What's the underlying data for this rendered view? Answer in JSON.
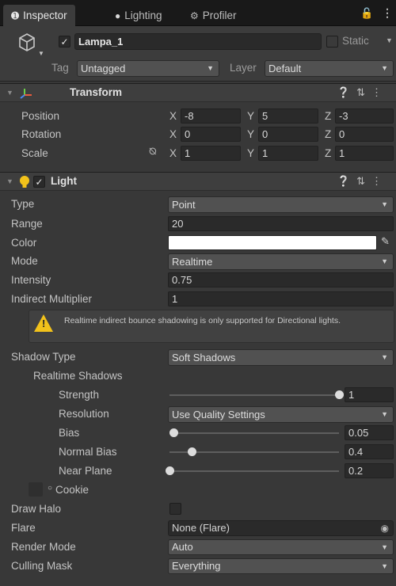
{
  "tabs": [
    {
      "label": "Inspector",
      "icon": "info-icon"
    },
    {
      "label": "Lighting",
      "icon": "bulb-icon"
    },
    {
      "label": "Profiler",
      "icon": "profiler-icon"
    }
  ],
  "object": {
    "name": "Lampa_1",
    "static_label": "Static",
    "tag_label": "Tag",
    "tag_value": "Untagged",
    "layer_label": "Layer",
    "layer_value": "Default"
  },
  "transform": {
    "title": "Transform",
    "rows": [
      {
        "label": "Position",
        "x": "-8",
        "y": "5",
        "z": "-3"
      },
      {
        "label": "Rotation",
        "x": "0",
        "y": "0",
        "z": "0"
      },
      {
        "label": "Scale",
        "x": "1",
        "y": "1",
        "z": "1"
      }
    ],
    "axis": {
      "x": "X",
      "y": "Y",
      "z": "Z"
    }
  },
  "light": {
    "title": "Light",
    "type_label": "Type",
    "type_value": "Point",
    "range_label": "Range",
    "range_value": "20",
    "color_label": "Color",
    "color_value": "#ffffff",
    "mode_label": "Mode",
    "mode_value": "Realtime",
    "intensity_label": "Intensity",
    "intensity_value": "0.75",
    "indirect_label": "Indirect Multiplier",
    "indirect_value": "1",
    "warning": "Realtime indirect bounce shadowing is only supported for Directional lights.",
    "shadow_type_label": "Shadow Type",
    "shadow_type_value": "Soft Shadows",
    "realtime_shadows_label": "Realtime Shadows",
    "strength_label": "Strength",
    "strength_value": "1",
    "strength_level": 1.0,
    "resolution_label": "Resolution",
    "resolution_value": "Use Quality Settings",
    "bias_label": "Bias",
    "bias_value": "0.05",
    "bias_level": 0.025,
    "normal_bias_label": "Normal Bias",
    "normal_bias_value": "0.4",
    "normal_bias_level": 0.13,
    "near_plane_label": "Near Plane",
    "near_plane_value": "0.2",
    "near_plane_level": 0.0,
    "cookie_label": "Cookie",
    "draw_halo_label": "Draw Halo",
    "flare_label": "Flare",
    "flare_value": "None (Flare)",
    "render_mode_label": "Render Mode",
    "render_mode_value": "Auto",
    "culling_label": "Culling Mask",
    "culling_value": "Everything"
  }
}
